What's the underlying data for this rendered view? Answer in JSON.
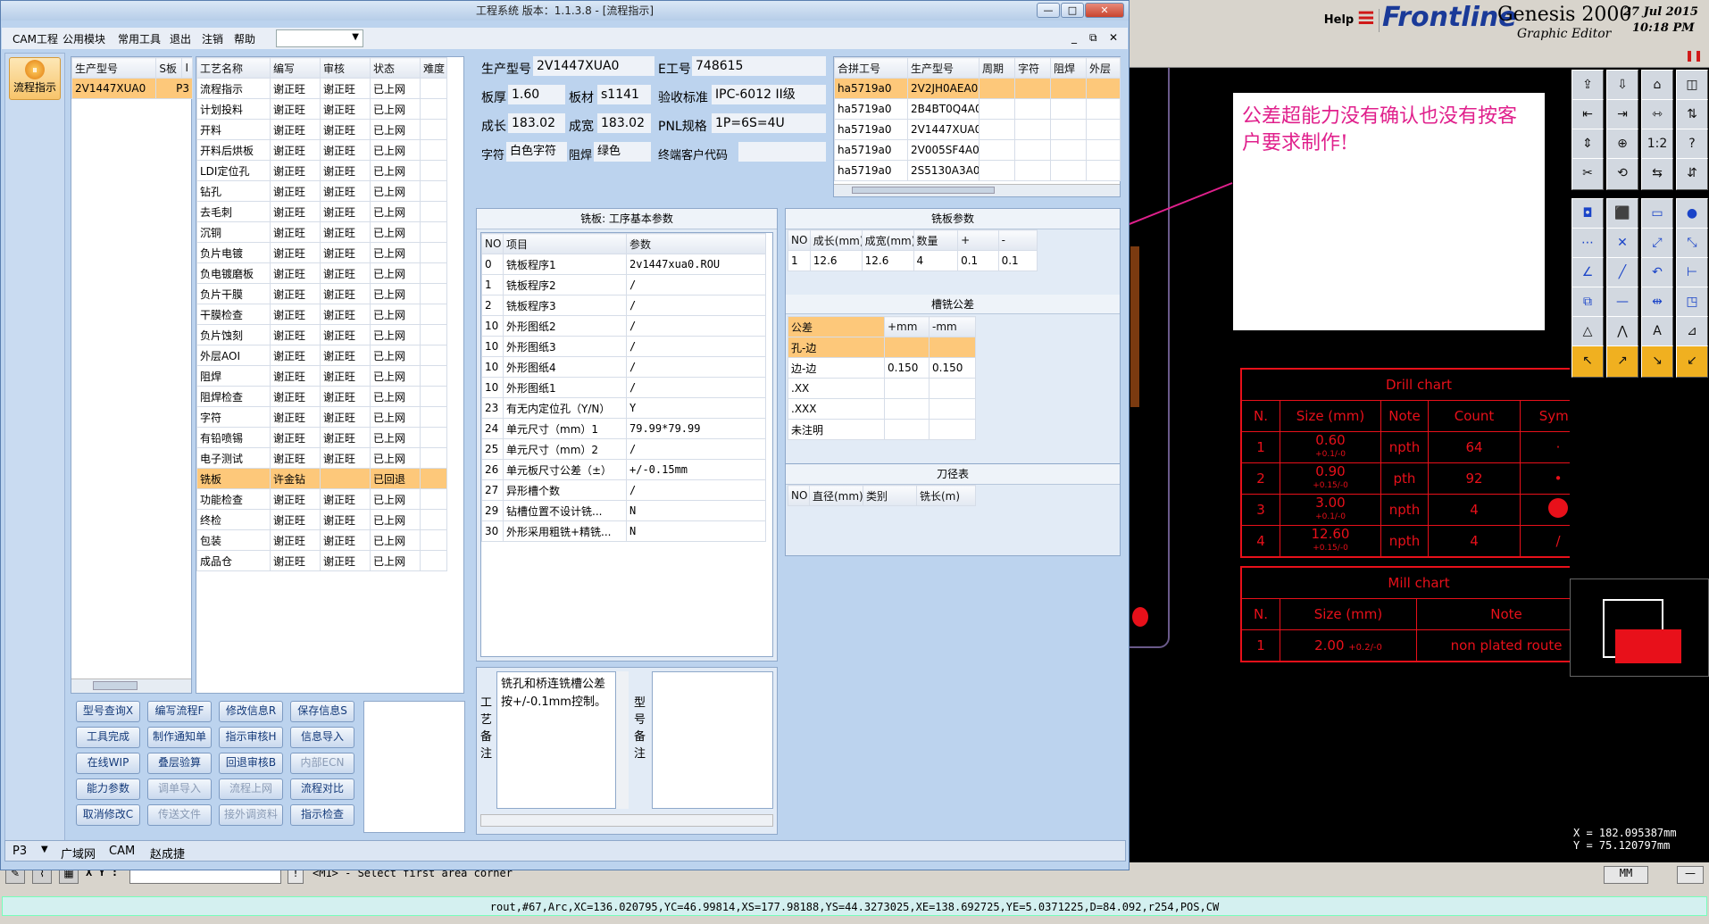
{
  "window": {
    "title": "工程系统  版本：1.1.3.8 - [流程指示]",
    "controls": [
      "—",
      "□",
      "✕"
    ]
  },
  "menubar": {
    "items": [
      "CAM工程",
      "公用模块",
      "常用工具",
      "退出",
      "注销",
      "帮助"
    ],
    "child_controls": [
      "_",
      "⧉",
      "✕"
    ]
  },
  "leftnav": {
    "item": "流程指示"
  },
  "jobs": {
    "headers": [
      "生产型号",
      "S板",
      "I"
    ],
    "rows": [
      [
        "2V1447XUA0",
        "P3"
      ]
    ]
  },
  "process": {
    "headers": [
      "工艺名称",
      "编写",
      "审核",
      "状态",
      "难度"
    ],
    "rows": [
      [
        "流程指示",
        "谢正旺",
        "谢正旺",
        "已上网"
      ],
      [
        "计划投料",
        "谢正旺",
        "谢正旺",
        "已上网"
      ],
      [
        "开料",
        "谢正旺",
        "谢正旺",
        "已上网"
      ],
      [
        "开料后烘板",
        "谢正旺",
        "谢正旺",
        "已上网"
      ],
      [
        "LDI定位孔",
        "谢正旺",
        "谢正旺",
        "已上网"
      ],
      [
        "钻孔",
        "谢正旺",
        "谢正旺",
        "已上网"
      ],
      [
        "去毛刺",
        "谢正旺",
        "谢正旺",
        "已上网"
      ],
      [
        "沉铜",
        "谢正旺",
        "谢正旺",
        "已上网"
      ],
      [
        "负片电镀",
        "谢正旺",
        "谢正旺",
        "已上网"
      ],
      [
        "负电镀磨板",
        "谢正旺",
        "谢正旺",
        "已上网"
      ],
      [
        "负片干膜",
        "谢正旺",
        "谢正旺",
        "已上网"
      ],
      [
        "干膜检查",
        "谢正旺",
        "谢正旺",
        "已上网"
      ],
      [
        "负片蚀刻",
        "谢正旺",
        "谢正旺",
        "已上网"
      ],
      [
        "外层AOI",
        "谢正旺",
        "谢正旺",
        "已上网"
      ],
      [
        "阻焊",
        "谢正旺",
        "谢正旺",
        "已上网"
      ],
      [
        "阻焊检查",
        "谢正旺",
        "谢正旺",
        "已上网"
      ],
      [
        "字符",
        "谢正旺",
        "谢正旺",
        "已上网"
      ],
      [
        "有铅喷锡",
        "谢正旺",
        "谢正旺",
        "已上网"
      ],
      [
        "电子测试",
        "谢正旺",
        "谢正旺",
        "已上网"
      ],
      [
        "铣板",
        "许金钻",
        "",
        "已回退"
      ],
      [
        "功能检查",
        "谢正旺",
        "谢正旺",
        "已上网"
      ],
      [
        "终检",
        "谢正旺",
        "谢正旺",
        "已上网"
      ],
      [
        "包装",
        "谢正旺",
        "谢正旺",
        "已上网"
      ],
      [
        "成品仓",
        "谢正旺",
        "谢正旺",
        "已上网"
      ]
    ],
    "selected_index": 19
  },
  "info": {
    "part_label": "生产型号",
    "part": "2V1447XUA0",
    "e_label": "E工号",
    "e_no": "748615",
    "thick_label": "板厚",
    "thick": "1.60",
    "mat_label": "板材",
    "mat": "s1141",
    "std_label": "验收标准",
    "std": "IPC-6012 II级",
    "len_label": "成长",
    "len": "183.02",
    "wid_label": "成宽",
    "wid": "183.02",
    "pnl_label": "PNL规格",
    "pnl": "1P=6S=4U",
    "char_label": "字符",
    "char": "白色字符",
    "mask_label": "阻焊",
    "mask": "绿色",
    "end_label": "终端客户代码",
    "end": ""
  },
  "combine": {
    "headers": [
      "合拼工号",
      "生产型号",
      "周期",
      "字符",
      "阻焊",
      "外层"
    ],
    "rows": [
      [
        "ha5719a0",
        "2V2JH0AEA0"
      ],
      [
        "ha5719a0",
        "2B4BT0Q4A0"
      ],
      [
        "ha5719a0",
        "2V1447XUA0"
      ],
      [
        "ha5719a0",
        "2V005SF4A0"
      ],
      [
        "ha5719a0",
        "2S5130A3A0"
      ]
    ]
  },
  "basic": {
    "title": "铣板: 工序基本参数",
    "headers": [
      "NO",
      "项目",
      "参数"
    ],
    "rows": [
      [
        "0",
        "铣板程序1",
        "2v1447xua0.ROU"
      ],
      [
        "1",
        "铣板程序2",
        "/"
      ],
      [
        "2",
        "铣板程序3",
        "/"
      ],
      [
        "10",
        "外形图纸2",
        "/"
      ],
      [
        "10",
        "外形图纸3",
        "/"
      ],
      [
        "10",
        "外形图纸4",
        "/"
      ],
      [
        "10",
        "外形图纸1",
        "/"
      ],
      [
        "23",
        "有无内定位孔（Y/N）",
        "Y"
      ],
      [
        "24",
        "单元尺寸（mm）1",
        "79.99*79.99"
      ],
      [
        "25",
        "单元尺寸（mm）2",
        "/"
      ],
      [
        "26",
        "单元板尺寸公差（±）",
        "+/-0.15mm"
      ],
      [
        "27",
        "异形槽个数",
        "/"
      ],
      [
        "29",
        "钻槽位置不设计铣...",
        "N"
      ],
      [
        "30",
        "外形采用粗铣+精铣...",
        "N"
      ]
    ]
  },
  "millparam": {
    "title": "铣板参数",
    "headers": [
      "NO",
      "成长(mm)",
      "成宽(mm)",
      "数量",
      "+",
      "-"
    ],
    "rows": [
      [
        "1",
        "12.6",
        "12.6",
        "4",
        "0.1",
        "0.1"
      ]
    ]
  },
  "slot": {
    "title": "槽铣公差",
    "headers": [
      "公差",
      "+mm",
      "-mm"
    ],
    "rows": [
      [
        "孔-边",
        "",
        ""
      ],
      [
        "边-边",
        "0.150",
        "0.150"
      ],
      [
        ".XX",
        "",
        ""
      ],
      [
        ".XXX",
        "",
        ""
      ],
      [
        "未注明",
        "",
        ""
      ]
    ]
  },
  "tool": {
    "title": "刀径表",
    "headers": [
      "NO",
      "直径(mm)",
      "类别",
      "铣长(m)"
    ]
  },
  "buttons": [
    [
      "型号查询X",
      "编写流程F",
      "修改信息R",
      "保存信息S"
    ],
    [
      "工具完成",
      "制作通知单",
      "指示审核H",
      "信息导入"
    ],
    [
      "在线WIP",
      "叠层验算",
      "回退审核B",
      "内部ECN"
    ],
    [
      "能力参数",
      "调单导入",
      "流程上网",
      "流程对比"
    ],
    [
      "取消修改C",
      "传送文件",
      "接外调资料",
      "指示检查"
    ]
  ],
  "remarks": {
    "craft_label": "工艺备注",
    "craft_text": "铣孔和桥连铣槽公差按+/-0.1mm控制。",
    "model_label": "型号备注",
    "model_text": ""
  },
  "statusbar": [
    "P3",
    "广域网",
    "CAM",
    "赵成捷"
  ],
  "genesis": {
    "help": "Help",
    "brand": "Frontline",
    "product": "Genesis 2000",
    "subtitle": "Graphic Editor",
    "date": "27 Jul 2015",
    "time": "10:18 PM",
    "note": "公差超能力没有确认也没有按客户要求制作!",
    "drill_title": "Drill chart",
    "drill_headers": [
      "N.",
      "Size (mm)",
      "Note",
      "Count",
      "Symb"
    ],
    "drill_rows": [
      [
        "1",
        "0.60",
        "+0.1/-0",
        "npth",
        "64"
      ],
      [
        "2",
        "0.90",
        "+0.15/-0",
        "pth",
        "92"
      ],
      [
        "3",
        "3.00",
        "+0.1/-0",
        "npth",
        "4"
      ],
      [
        "4",
        "12.60",
        "+0.15/-0",
        "npth",
        "4"
      ]
    ],
    "mill_title": "Mill chart",
    "mill_headers": [
      "N.",
      "Size (mm)",
      "Note"
    ],
    "mill_rows": [
      [
        "1",
        "2.00",
        "+0.2/-0",
        "non plated route"
      ]
    ],
    "coord_x": "X = 182.095387mm",
    "coord_y": "Y =  75.120797mm",
    "xy_label": "X Y :",
    "prompt": "<M1> - Select first area corner",
    "unit": "MM",
    "statusline": "rout,#67,Arc,XC=136.020795,YC=46.99814,XS=177.98188,YS=44.3273025,XE=138.692725,YE=5.0371225,D=84.092,r254,POS,CW"
  },
  "colors": {
    "accent": "#fdc87a",
    "chart": "#e8101a",
    "arrow": "#e0208c"
  }
}
